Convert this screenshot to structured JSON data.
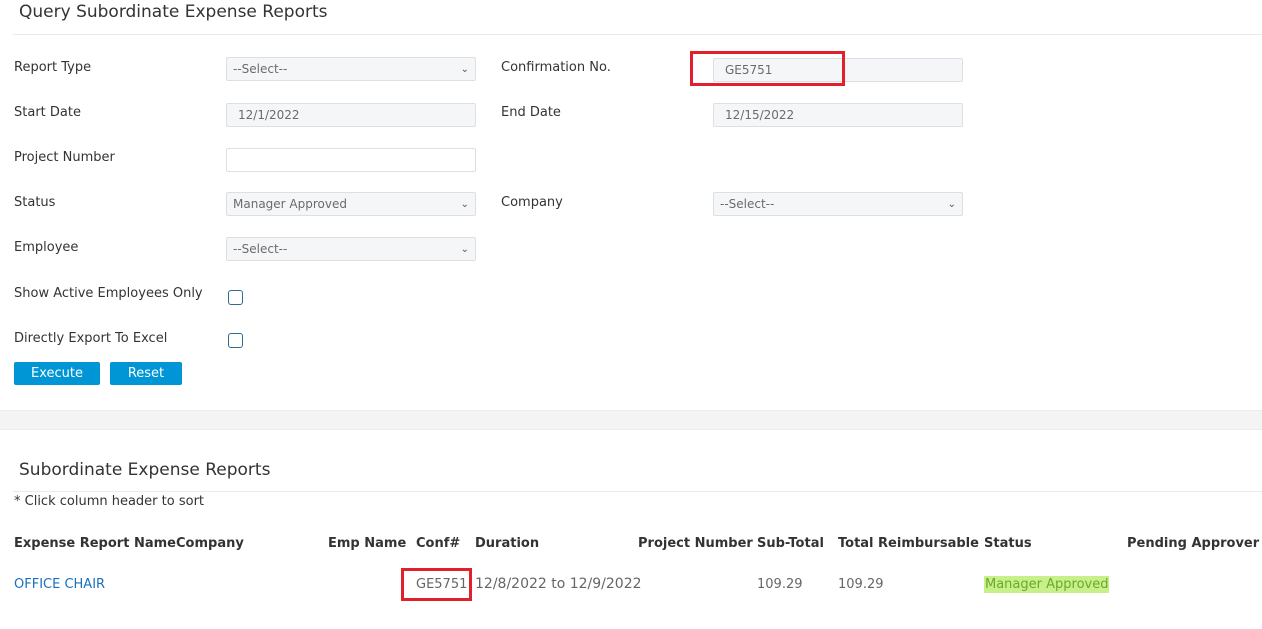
{
  "query": {
    "title": "Query Subordinate Expense Reports",
    "report_type": {
      "label": "Report Type",
      "value": "--Select--"
    },
    "confirmation_no": {
      "label": "Confirmation No.",
      "value": "GE5751"
    },
    "start_date": {
      "label": "Start Date",
      "value": "12/1/2022"
    },
    "end_date": {
      "label": "End Date",
      "value": "12/15/2022"
    },
    "project_number": {
      "label": "Project Number",
      "value": ""
    },
    "status": {
      "label": "Status",
      "value": "Manager Approved"
    },
    "company": {
      "label": "Company",
      "value": "--Select--"
    },
    "employee": {
      "label": "Employee",
      "value": "--Select--"
    },
    "show_active": {
      "label": "Show Active Employees Only",
      "checked": false
    },
    "export_excel": {
      "label": "Directly Export To Excel",
      "checked": false
    },
    "execute_label": "Execute",
    "reset_label": "Reset"
  },
  "results": {
    "title": "Subordinate Expense Reports",
    "hint": "* Click column header to sort",
    "columns": [
      "Expense Report Name",
      "Company",
      "Emp Name",
      "Conf#",
      "Duration",
      "Project Number",
      "Sub-Total",
      "Total Reimbursable",
      "Status",
      "Pending Approver"
    ],
    "rows": [
      {
        "name": "OFFICE CHAIR",
        "company": "",
        "emp_name": "",
        "conf": "GE5751",
        "duration": "12/8/2022 to 12/9/2022",
        "project_number": "",
        "subtotal": "109.29",
        "total": "109.29",
        "status": "Manager Approved",
        "pending": ""
      }
    ]
  },
  "colors": {
    "accent": "#0096d6",
    "highlight_box": "#e0202a",
    "status_highlight": "#c8f08a",
    "link": "#1a6fbf"
  },
  "icons": [
    "chevron-down-icon"
  ]
}
